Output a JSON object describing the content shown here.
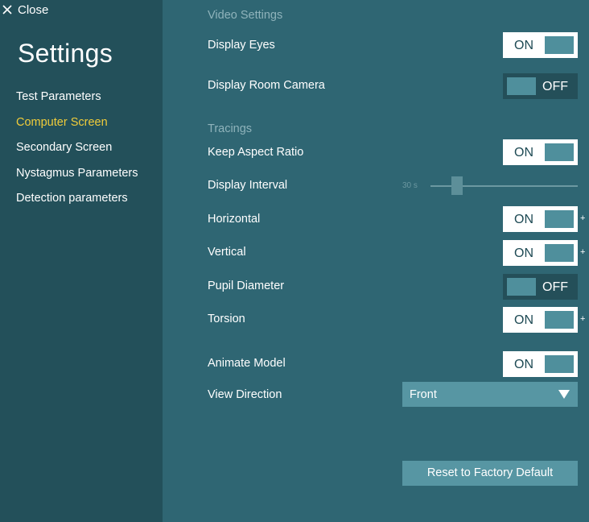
{
  "sidebar": {
    "close_label": "Close",
    "title": "Settings",
    "items": [
      {
        "label": "Test Parameters",
        "active": false
      },
      {
        "label": "Computer Screen",
        "active": true
      },
      {
        "label": "Secondary Screen",
        "active": false
      },
      {
        "label": "Nystagmus Parameters",
        "active": false
      },
      {
        "label": "Detection parameters",
        "active": false
      }
    ]
  },
  "video_settings": {
    "header": "Video Settings",
    "display_eyes": {
      "label": "Display Eyes",
      "state": "ON"
    },
    "display_room_camera": {
      "label": "Display Room Camera",
      "state": "OFF"
    }
  },
  "tracings": {
    "header": "Tracings",
    "keep_aspect_ratio": {
      "label": "Keep Aspect Ratio",
      "state": "ON"
    },
    "display_interval": {
      "label": "Display Interval",
      "value_text": "30 s"
    },
    "horizontal": {
      "label": "Horizontal",
      "state": "ON",
      "extra": "+"
    },
    "vertical": {
      "label": "Vertical",
      "state": "ON",
      "extra": "+"
    },
    "pupil_diameter": {
      "label": "Pupil Diameter",
      "state": "OFF"
    },
    "torsion": {
      "label": "Torsion",
      "state": "ON",
      "extra": "+"
    }
  },
  "model": {
    "animate_model": {
      "label": "Animate Model",
      "state": "ON"
    },
    "view_direction": {
      "label": "View Direction",
      "selected": "Front"
    }
  },
  "reset_button_label": "Reset to Factory Default",
  "colors": {
    "sidebar_bg": "#23505a",
    "main_bg": "#2f6673",
    "accent_active": "#f0cc3a",
    "control_bg": "#5796a3"
  }
}
